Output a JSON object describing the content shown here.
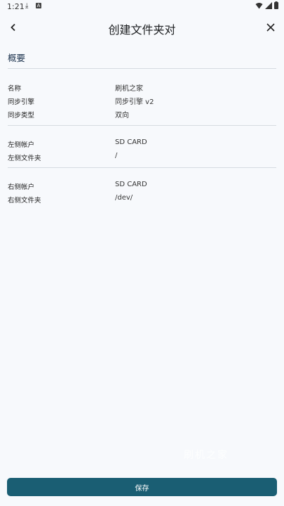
{
  "status_bar": {
    "time": "1:21"
  },
  "app_bar": {
    "title": "创建文件夹对"
  },
  "section": {
    "title": "概要"
  },
  "general": [
    {
      "label": "名称",
      "value": "刷机之家"
    },
    {
      "label": "同步引擎",
      "value": "同步引擎 v2"
    },
    {
      "label": "同步类型",
      "value": "双向"
    }
  ],
  "left": [
    {
      "label": "左侧帐户",
      "value": "SD CARD"
    },
    {
      "label": "左侧文件夹",
      "value": "/"
    }
  ],
  "right": [
    {
      "label": "右侧帐户",
      "value": "SD CARD"
    },
    {
      "label": "右侧文件夹",
      "value": "/dev/"
    }
  ],
  "save_label": "保存",
  "watermark": "刷机之家",
  "colors": {
    "accent": "#1a5e73",
    "background": "#f7f9fc"
  }
}
